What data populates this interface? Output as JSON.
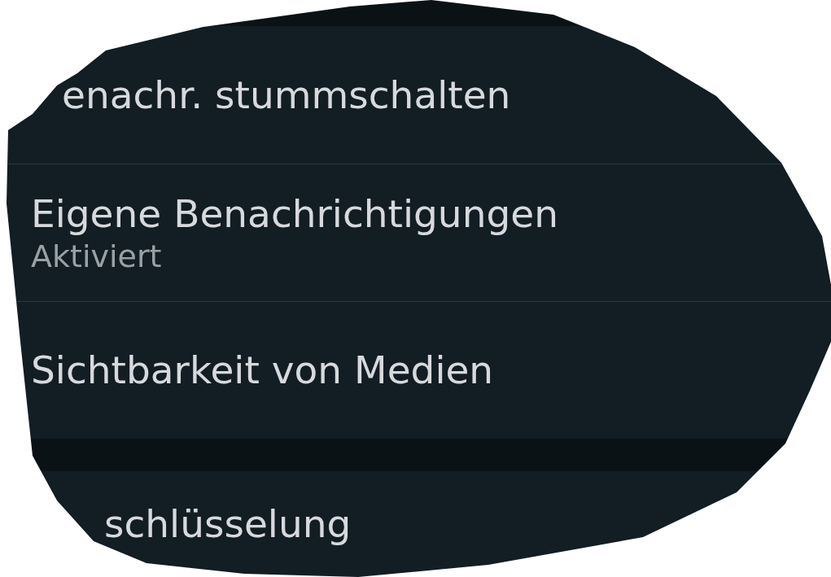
{
  "sections": [
    {
      "items": [
        {
          "title": "enachr. stummschalten"
        },
        {
          "title": "Eigene Benachrichtigungen",
          "subtitle": "Aktiviert"
        },
        {
          "title": "Sichtbarkeit von Medien"
        }
      ]
    },
    {
      "items": [
        {
          "title": "schlüsselung"
        }
      ]
    }
  ]
}
